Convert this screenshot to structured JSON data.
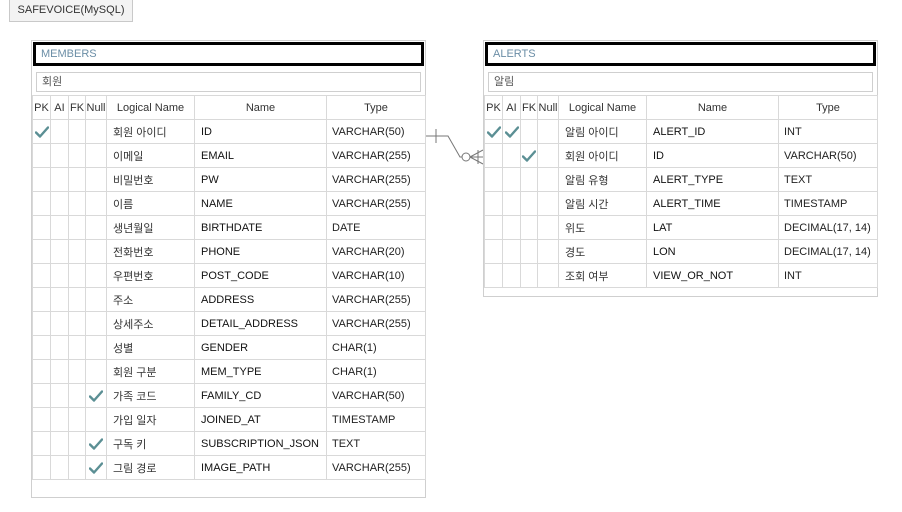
{
  "toolbar": {
    "tab_label": "SAFEVOICE(MySQL)"
  },
  "headers": [
    "PK",
    "AI",
    "FK",
    "Null",
    "Logical Name",
    "Name",
    "Type"
  ],
  "entities": [
    {
      "title": "MEMBERS",
      "subtitle": "회원",
      "rows": [
        {
          "pk": true,
          "ai": false,
          "fk": false,
          "null": false,
          "logical": "회원 아이디",
          "name": "ID",
          "type": "VARCHAR(50)"
        },
        {
          "pk": false,
          "ai": false,
          "fk": false,
          "null": false,
          "logical": "이메일",
          "name": "EMAIL",
          "type": "VARCHAR(255)"
        },
        {
          "pk": false,
          "ai": false,
          "fk": false,
          "null": false,
          "logical": "비밀번호",
          "name": "PW",
          "type": "VARCHAR(255)"
        },
        {
          "pk": false,
          "ai": false,
          "fk": false,
          "null": false,
          "logical": "이름",
          "name": "NAME",
          "type": "VARCHAR(255)"
        },
        {
          "pk": false,
          "ai": false,
          "fk": false,
          "null": false,
          "logical": "생년월일",
          "name": "BIRTHDATE",
          "type": "DATE"
        },
        {
          "pk": false,
          "ai": false,
          "fk": false,
          "null": false,
          "logical": "전화번호",
          "name": "PHONE",
          "type": "VARCHAR(20)"
        },
        {
          "pk": false,
          "ai": false,
          "fk": false,
          "null": false,
          "logical": "우편번호",
          "name": "POST_CODE",
          "type": "VARCHAR(10)"
        },
        {
          "pk": false,
          "ai": false,
          "fk": false,
          "null": false,
          "logical": "주소",
          "name": "ADDRESS",
          "type": "VARCHAR(255)"
        },
        {
          "pk": false,
          "ai": false,
          "fk": false,
          "null": false,
          "logical": "상세주소",
          "name": "DETAIL_ADDRESS",
          "type": "VARCHAR(255)"
        },
        {
          "pk": false,
          "ai": false,
          "fk": false,
          "null": false,
          "logical": "성별",
          "name": "GENDER",
          "type": "CHAR(1)"
        },
        {
          "pk": false,
          "ai": false,
          "fk": false,
          "null": false,
          "logical": "회원 구분",
          "name": "MEM_TYPE",
          "type": "CHAR(1)"
        },
        {
          "pk": false,
          "ai": false,
          "fk": false,
          "null": true,
          "logical": "가족 코드",
          "name": "FAMILY_CD",
          "type": "VARCHAR(50)"
        },
        {
          "pk": false,
          "ai": false,
          "fk": false,
          "null": false,
          "logical": "가입 일자",
          "name": "JOINED_AT",
          "type": "TIMESTAMP"
        },
        {
          "pk": false,
          "ai": false,
          "fk": false,
          "null": true,
          "logical": "구독 키",
          "name": "SUBSCRIPTION_JSON",
          "type": "TEXT"
        },
        {
          "pk": false,
          "ai": false,
          "fk": false,
          "null": true,
          "logical": "그림 경로",
          "name": "IMAGE_PATH",
          "type": "VARCHAR(255)"
        }
      ]
    },
    {
      "title": "ALERTS",
      "subtitle": "알림",
      "rows": [
        {
          "pk": true,
          "ai": true,
          "fk": false,
          "null": false,
          "logical": "알림 아이디",
          "name": "ALERT_ID",
          "type": "INT"
        },
        {
          "pk": false,
          "ai": false,
          "fk": true,
          "null": false,
          "logical": "회원 아이디",
          "name": "ID",
          "type": "VARCHAR(50)"
        },
        {
          "pk": false,
          "ai": false,
          "fk": false,
          "null": false,
          "logical": "알림 유형",
          "name": "ALERT_TYPE",
          "type": "TEXT"
        },
        {
          "pk": false,
          "ai": false,
          "fk": false,
          "null": false,
          "logical": "알림 시간",
          "name": "ALERT_TIME",
          "type": "TIMESTAMP"
        },
        {
          "pk": false,
          "ai": false,
          "fk": false,
          "null": false,
          "logical": "위도",
          "name": "LAT",
          "type": "DECIMAL(17, 14)"
        },
        {
          "pk": false,
          "ai": false,
          "fk": false,
          "null": false,
          "logical": "경도",
          "name": "LON",
          "type": "DECIMAL(17, 14)"
        },
        {
          "pk": false,
          "ai": false,
          "fk": false,
          "null": false,
          "logical": "조회 여부",
          "name": "VIEW_OR_NOT",
          "type": "INT"
        }
      ]
    }
  ],
  "colors": {
    "title_text": "#6b8ea6",
    "check": "#5b8f94",
    "border": "#d9d9d9"
  },
  "icons": {
    "flag": "check-icon"
  }
}
